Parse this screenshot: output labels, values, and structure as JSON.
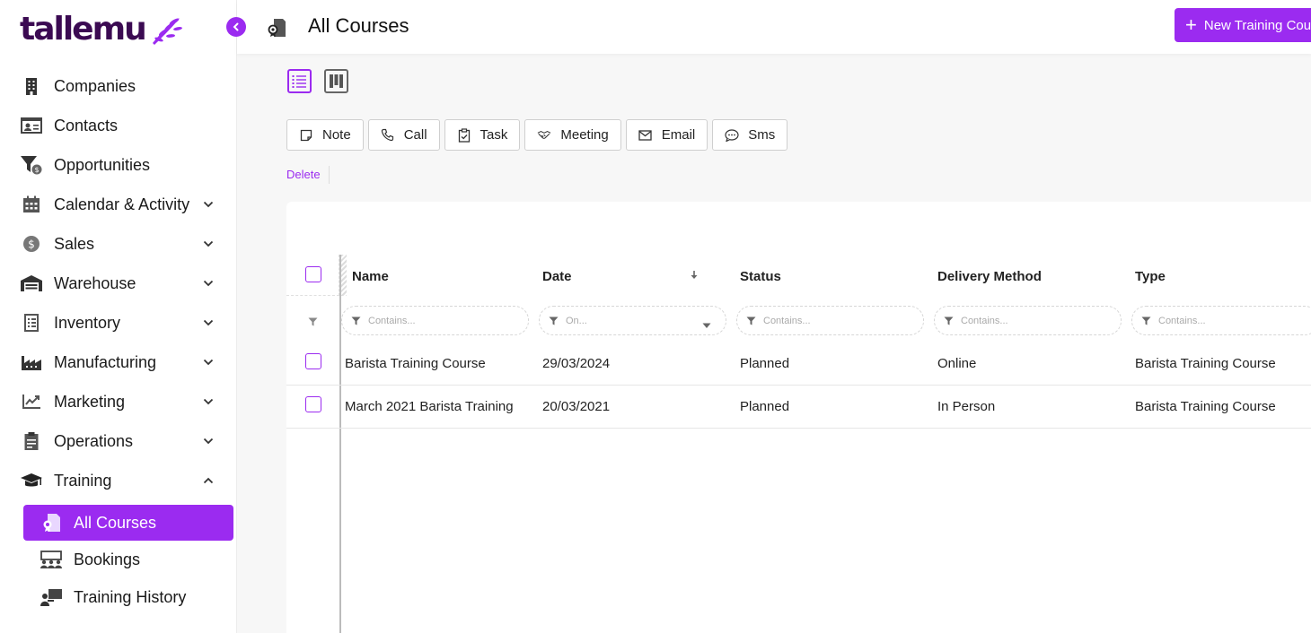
{
  "brand": {
    "logo_text": "tallemu",
    "accent": "#9b2bf0",
    "logo_color": "#3b0a52"
  },
  "sidebar": {
    "items": [
      {
        "label": "Companies",
        "icon": "building-icon",
        "expandable": false
      },
      {
        "label": "Contacts",
        "icon": "contact-card-icon",
        "expandable": false
      },
      {
        "label": "Opportunities",
        "icon": "funnel-dollar-icon",
        "expandable": false
      },
      {
        "label": "Calendar & Activity",
        "icon": "calendar-icon",
        "expandable": true
      },
      {
        "label": "Sales",
        "icon": "dollar-coin-icon",
        "expandable": true
      },
      {
        "label": "Warehouse",
        "icon": "warehouse-icon",
        "expandable": true
      },
      {
        "label": "Inventory",
        "icon": "inventory-list-icon",
        "expandable": true
      },
      {
        "label": "Manufacturing",
        "icon": "factory-icon",
        "expandable": true
      },
      {
        "label": "Marketing",
        "icon": "trend-chart-icon",
        "expandable": true
      },
      {
        "label": "Operations",
        "icon": "clipboard-icon",
        "expandable": true
      },
      {
        "label": "Training",
        "icon": "graduation-cap-icon",
        "expandable": true,
        "expanded": true
      }
    ],
    "sub_items": [
      {
        "label": "All Courses",
        "icon": "course-icon",
        "active": true
      },
      {
        "label": "Bookings",
        "icon": "group-icon",
        "active": false
      },
      {
        "label": "Training History",
        "icon": "presenter-icon",
        "active": false
      }
    ]
  },
  "header": {
    "title": "All Courses",
    "new_button_label": "New Training Course"
  },
  "actions": {
    "note": "Note",
    "call": "Call",
    "task": "Task",
    "meeting": "Meeting",
    "email": "Email",
    "sms": "Sms",
    "delete": "Delete"
  },
  "table": {
    "columns": [
      "Name",
      "Date",
      "Status",
      "Delivery Method",
      "Type"
    ],
    "filters": {
      "name": "Contains...",
      "date": "On...",
      "status": "Contains...",
      "delivery": "Contains...",
      "type": "Contains..."
    },
    "rows": [
      {
        "name": "Barista Training Course",
        "date": "29/03/2024",
        "status": "Planned",
        "delivery": "Online",
        "type": "Barista Training Course"
      },
      {
        "name": "March 2021 Barista Training",
        "date": "20/03/2021",
        "status": "Planned",
        "delivery": "In Person",
        "type": "Barista Training Course"
      }
    ]
  }
}
